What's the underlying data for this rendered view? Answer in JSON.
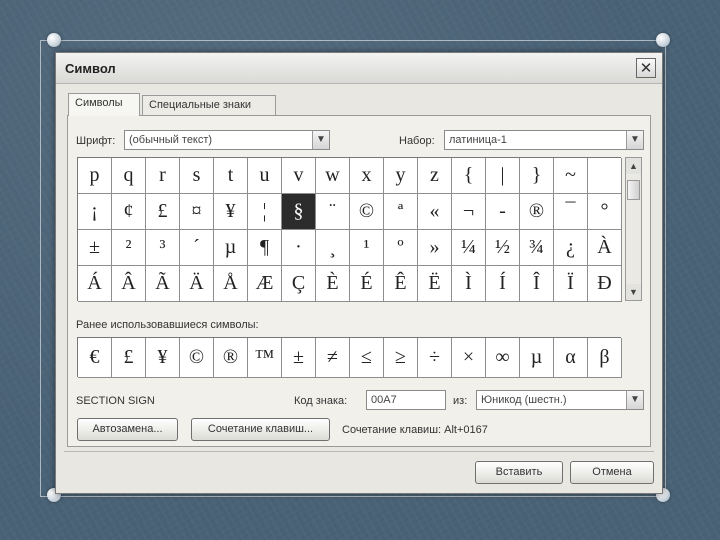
{
  "dialog": {
    "title": "Символ",
    "close_glyph": "✕"
  },
  "tabs": [
    {
      "label": "Символы",
      "active": true
    },
    {
      "label": "Специальные знаки",
      "active": false
    }
  ],
  "font": {
    "label": "Шрифт:",
    "value": "(обычный текст)"
  },
  "subset": {
    "label": "Набор:",
    "value": "латиница-1"
  },
  "symbols": [
    [
      "p",
      "q",
      "r",
      "s",
      "t",
      "u",
      "v",
      "w",
      "x",
      "y",
      "z",
      "{",
      "|",
      "}",
      "~",
      ""
    ],
    [
      "¡",
      "¢",
      "£",
      "¤",
      "¥",
      "¦",
      "§",
      "¨",
      "©",
      "ª",
      "«",
      "¬",
      "-",
      "®",
      "¯",
      "°"
    ],
    [
      "±",
      "²",
      "³",
      "´",
      "µ",
      "¶",
      "·",
      "¸",
      "¹",
      "º",
      "»",
      "¼",
      "½",
      "¾",
      "¿",
      "À"
    ],
    [
      "Á",
      "Â",
      "Ã",
      "Ä",
      "Å",
      "Æ",
      "Ç",
      "È",
      "É",
      "Ê",
      "Ë",
      "Ì",
      "Í",
      "Î",
      "Ï",
      "Ð"
    ]
  ],
  "selected_symbol": "§",
  "recent": {
    "label": "Ранее использовавшиеся символы:",
    "symbols": [
      "€",
      "£",
      "¥",
      "©",
      "®",
      "™",
      "±",
      "≠",
      "≤",
      "≥",
      "÷",
      "×",
      "∞",
      "µ",
      "α",
      "β"
    ]
  },
  "char_name": "SECTION SIGN",
  "code": {
    "label": "Код знака:",
    "value": "00A7"
  },
  "from": {
    "label": "из:",
    "value": "Юникод (шестн.)"
  },
  "buttons": {
    "autocorrect": "Автозамена...",
    "shortcut_key": "Сочетание клавиш...",
    "insert": "Вставить",
    "cancel": "Отмена"
  },
  "shortcut_text": "Сочетание клавиш: Alt+0167",
  "arrows": {
    "down": "▼",
    "up": "▲"
  },
  "icons": {
    "close": "close-icon",
    "dropdown": "chevron-down-icon"
  }
}
